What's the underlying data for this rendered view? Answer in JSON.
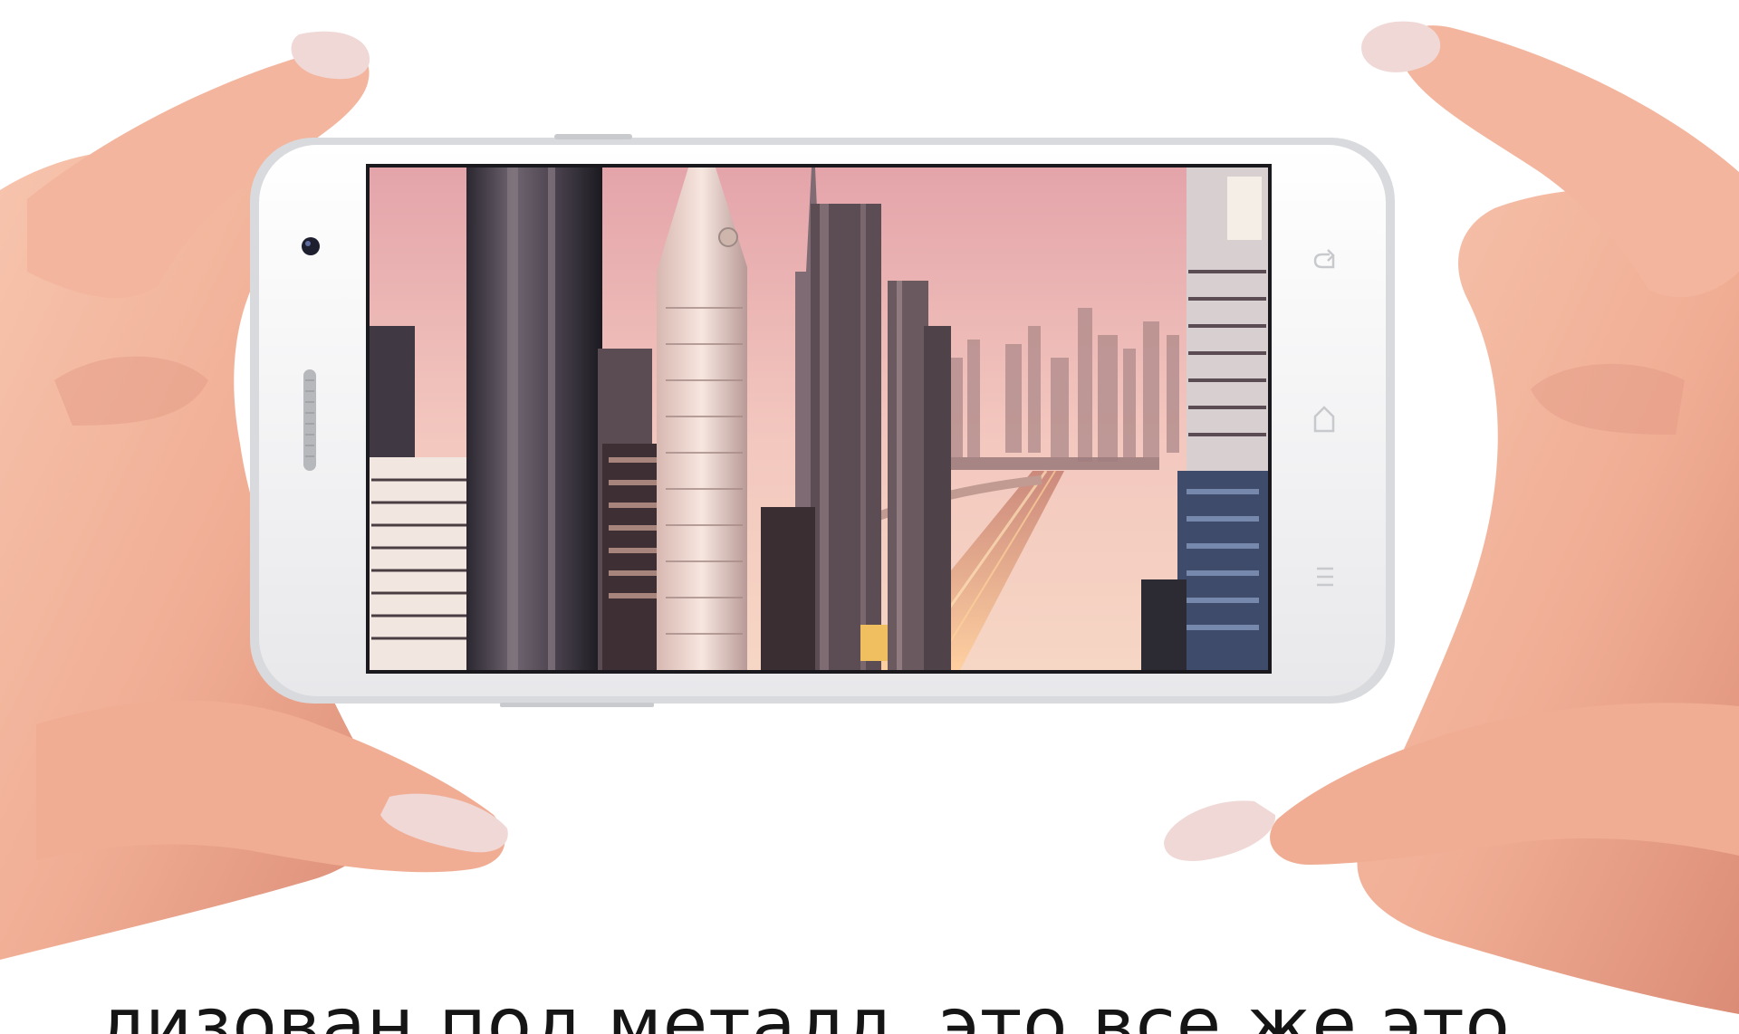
{
  "caption": {
    "text": "лизован под металл, это все же это"
  },
  "phone": {
    "body_color": "#f4f4f6",
    "frame_color": "#d9dadd",
    "screen_scene": "city skyline at sunset"
  },
  "colors": {
    "skin": "#f2b69f",
    "skin_shadow": "#d88f7b",
    "nail": "#f0d8d6",
    "sky_top": "#e4a4aa",
    "sky_bottom": "#f3c8bf"
  },
  "icons": {
    "front_camera": "front-camera-icon",
    "speaker": "speaker-grille-icon",
    "back": "back-button-icon",
    "home": "home-button-icon",
    "menu": "menu-button-icon"
  }
}
